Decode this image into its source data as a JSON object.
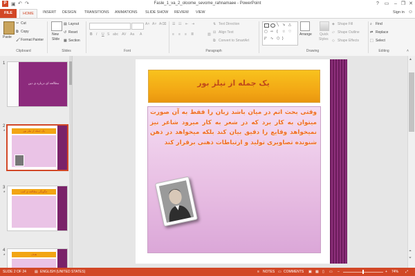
{
  "window": {
    "title": "Fasle_1_va_2_oloome_sevome_rahnamaee - PowerPoint",
    "help": "?",
    "sign_in": "Sign in"
  },
  "tabs": [
    "FILE",
    "HOME",
    "INSERT",
    "DESIGN",
    "TRANSITIONS",
    "ANIMATIONS",
    "SLIDE SHOW",
    "REVIEW",
    "VIEW"
  ],
  "ribbon": {
    "clipboard": {
      "paste": "Paste",
      "cut": "Cut",
      "copy": "Copy",
      "format_painter": "Format Painter",
      "label": "Clipboard"
    },
    "slides": {
      "new_slide_line1": "New",
      "new_slide_line2": "Slide",
      "layout": "Layout",
      "reset": "Reset",
      "section": "Section",
      "label": "Slides"
    },
    "font": {
      "label": "Font"
    },
    "paragraph": {
      "text_direction": "Text Direction",
      "align_text": "Align Text",
      "convert_smartart": "Convert to SmartArt",
      "label": "Paragraph"
    },
    "drawing": {
      "arrange": "Arrange",
      "quick_styles_1": "Quick",
      "quick_styles_2": "Styles",
      "shape_fill": "Shape Fill",
      "shape_outline": "Shape Outline",
      "shape_effects": "Shape Effects",
      "label": "Drawing"
    },
    "editing": {
      "find": "Find",
      "replace": "Replace",
      "select": "Select",
      "label": "Editing"
    }
  },
  "thumbnails": [
    {
      "number": "1",
      "star": "",
      "title": "مطالعه ای درباره ی دین"
    },
    {
      "number": "2",
      "star": "*",
      "title": "یک جمله از نیلز بور"
    },
    {
      "number": "3",
      "star": "*",
      "title": "چگونگی مطالعه ی کتب"
    },
    {
      "number": "4",
      "star": "*",
      "title": "هدف"
    }
  ],
  "slide": {
    "title": "یک جمله از نیلز بور",
    "body": "وقتی بحث اتم در میان باشد زبان را فقط به آن صورت میتوان به کار برد که در شعر به کار میرود شاعر نیز نمیخواهد وقایع را دقیق بیان کند بلکه میخواهد در ذهن شنونده تصاویری تولید و ارتباطات ذهنی برقرار کند"
  },
  "status": {
    "slide_counter": "SLIDE 2 OF 24",
    "language": "ENGLISH (UNITED STATES)",
    "notes": "NOTES",
    "comments": "COMMENTS",
    "zoom": "74%"
  },
  "colors": {
    "accent": "#d24726",
    "slide_title_fill": "#f2a514",
    "slide_body_fill": "#e7bce2",
    "slide_text": "#ef6a24",
    "band": "#7a2269"
  }
}
